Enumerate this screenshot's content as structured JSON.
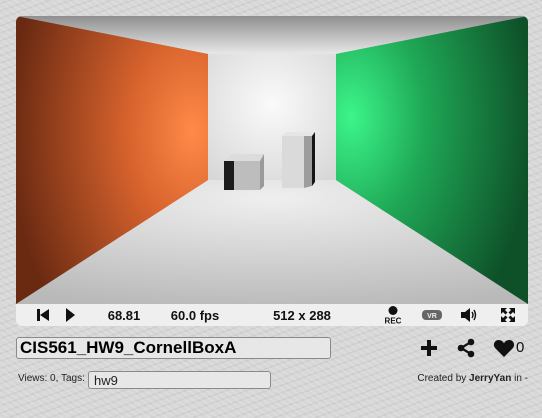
{
  "shader": {
    "title": "CIS561_HW9_CornellBoxA",
    "views_label": "Views: 0, Tags:",
    "tags_value": "hw9",
    "created_prefix": "Created by",
    "author": "JerryYan",
    "created_suffix": "in -",
    "likes": "0"
  },
  "player": {
    "time": "68.81",
    "fps": "60.0 fps",
    "resolution": "512 x 288",
    "rec_label": "REC",
    "vr_label": "VR"
  },
  "icons": {
    "rewind": "skip-back-icon",
    "play": "play-icon",
    "record": "record-icon",
    "vr": "vr-headset-icon",
    "volume": "volume-icon",
    "fullscreen": "fullscreen-icon",
    "add": "plus-icon",
    "share": "share-icon",
    "like": "heart-icon"
  },
  "colors": {
    "left_wall": "#f0824a",
    "right_wall": "#36e37a",
    "back_wall": "#f0f0f0",
    "ceiling": "#9c9c9c",
    "floor": "#dcdcdc"
  }
}
